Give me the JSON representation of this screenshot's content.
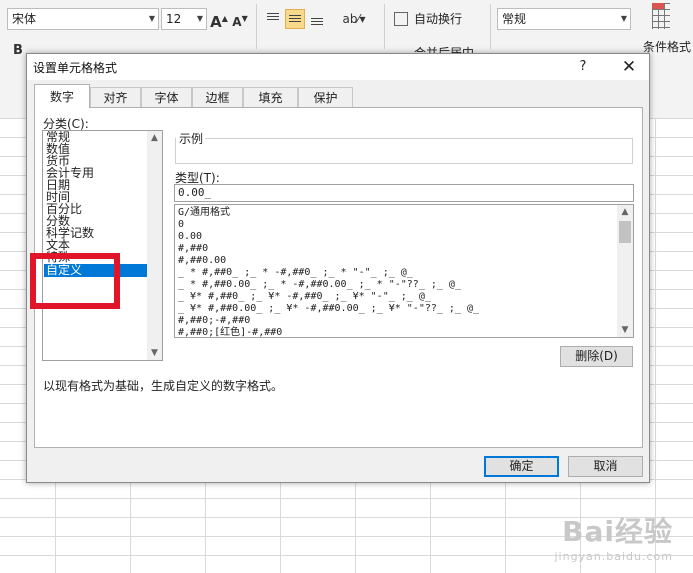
{
  "ribbon": {
    "font_name": "宋体",
    "font_size": "12",
    "grow_font": "A",
    "shrink_font": "A",
    "bold": "B",
    "wrap_text": "自动换行",
    "merge_center": "合并后居中",
    "number_format": "常规",
    "conditional_format": "条件格式"
  },
  "dialog": {
    "title": "设置单元格格式",
    "help": "?",
    "close": "✕",
    "tabs": [
      {
        "label": "数字",
        "active": true
      },
      {
        "label": "对齐",
        "active": false
      },
      {
        "label": "字体",
        "active": false
      },
      {
        "label": "边框",
        "active": false
      },
      {
        "label": "填充",
        "active": false
      },
      {
        "label": "保护",
        "active": false
      }
    ],
    "category_label": "分类(C):",
    "categories": [
      "常规",
      "数值",
      "货币",
      "会计专用",
      "日期",
      "时间",
      "百分比",
      "分数",
      "科学记数",
      "文本",
      "特殊",
      "自定义"
    ],
    "selected_category": "自定义",
    "sample_label": "示例",
    "type_label": "类型(T):",
    "type_value": "0.00_",
    "formats": [
      "G/通用格式",
      "0",
      "0.00",
      "#,##0",
      "#,##0.00",
      "_ * #,##0_ ;_ * -#,##0_ ;_ * \"-\"_ ;_ @_",
      "_ * #,##0.00_ ;_ * -#,##0.00_ ;_ * \"-\"??_ ;_ @_",
      "_ ¥* #,##0_ ;_ ¥* -#,##0_ ;_ ¥* \"-\"_ ;_ @_",
      "_ ¥* #,##0.00_ ;_ ¥* -#,##0.00_ ;_ ¥* \"-\"??_ ;_ @_",
      "#,##0;-#,##0",
      "#,##0;[红色]-#,##0"
    ],
    "delete_label": "删除(D)",
    "description": "以现有格式为基础，生成自定义的数字格式。",
    "ok_label": "确定",
    "cancel_label": "取消"
  },
  "watermark": {
    "brand": "Bai经验",
    "url": "jingyan.baidu.com"
  },
  "colors": {
    "selection": "#0078d7",
    "highlight_box": "#e0152a",
    "dialog_bg": "#f0f0f0"
  }
}
